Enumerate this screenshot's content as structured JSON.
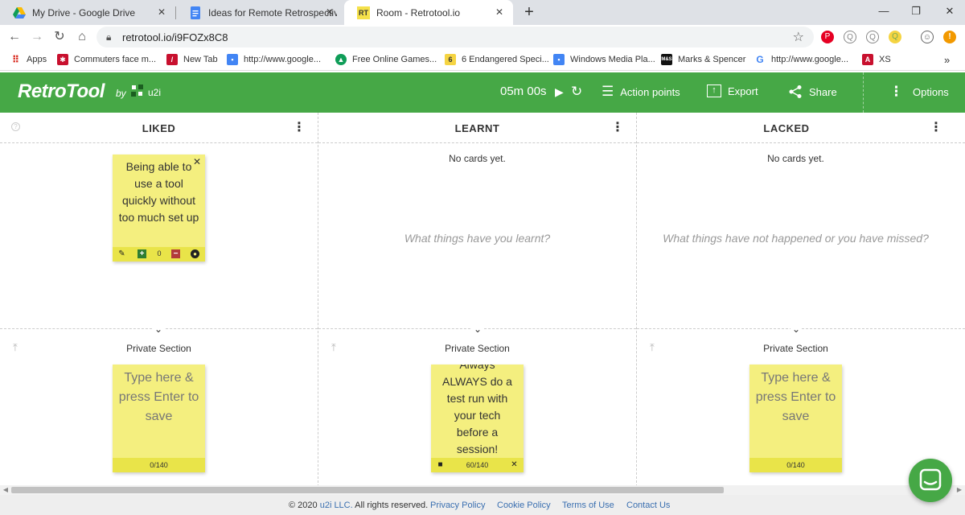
{
  "browser": {
    "tabs": [
      {
        "title": "My Drive - Google Drive",
        "close": "✕"
      },
      {
        "title": "Ideas for Remote Retrospectives",
        "close": "✕"
      },
      {
        "title": "Room - Retrotool.io",
        "close": "✕",
        "favicon_text": "RT"
      }
    ],
    "new_tab": "+",
    "window_controls": {
      "minimize": "—",
      "restore": "❐",
      "close": "✕"
    },
    "url": "retrotool.io/i9FOZx8C8",
    "bookmarks": [
      {
        "label": "Apps"
      },
      {
        "label": "Commuters face m..."
      },
      {
        "label": "New Tab"
      },
      {
        "label": "http://www.google..."
      },
      {
        "label": "Free Online Games..."
      },
      {
        "label": "6 Endangered Speci..."
      },
      {
        "label": "Windows Media Pla..."
      },
      {
        "label": "Marks & Spencer",
        "icon_text": "M&S"
      },
      {
        "label": "http://www.google..."
      },
      {
        "label": "XS"
      }
    ],
    "bookmarks_more": "»"
  },
  "app": {
    "logo": "RetroTool",
    "by": "by",
    "brand": "u2i",
    "accent_color": "#46a846",
    "timer": "05m 00s",
    "action_points": "Action points",
    "export": "Export",
    "share": "Share",
    "options": "Options"
  },
  "columns": [
    {
      "title": "LIKED",
      "cards": [
        {
          "text": "Being able to use a tool quickly without too much set up",
          "votes": "0"
        }
      ],
      "private_title": "Private Section",
      "draft": {
        "placeholder": "Type here & press Enter to save",
        "counter": "0/140"
      }
    },
    {
      "title": "LEARNT",
      "empty": "No cards yet.",
      "hint": "What things have you learnt?",
      "private_title": "Private Section",
      "draft": {
        "lines": [
          "Always",
          "ALWAYS do a",
          "test run with",
          "your tech",
          "before a",
          "session!"
        ],
        "counter": "60/140"
      }
    },
    {
      "title": "LACKED",
      "empty": "No cards yet.",
      "hint": "What things have not happened or you have missed?",
      "private_title": "Private Section",
      "draft": {
        "placeholder": "Type here & press Enter to save",
        "counter": "0/140"
      }
    }
  ],
  "footer": {
    "copyright_prefix": "© 2020",
    "company": "u2i LLC.",
    "rights": "All rights reserved.",
    "links": [
      "Privacy Policy",
      "Cookie Policy",
      "Terms of Use",
      "Contact Us"
    ]
  }
}
